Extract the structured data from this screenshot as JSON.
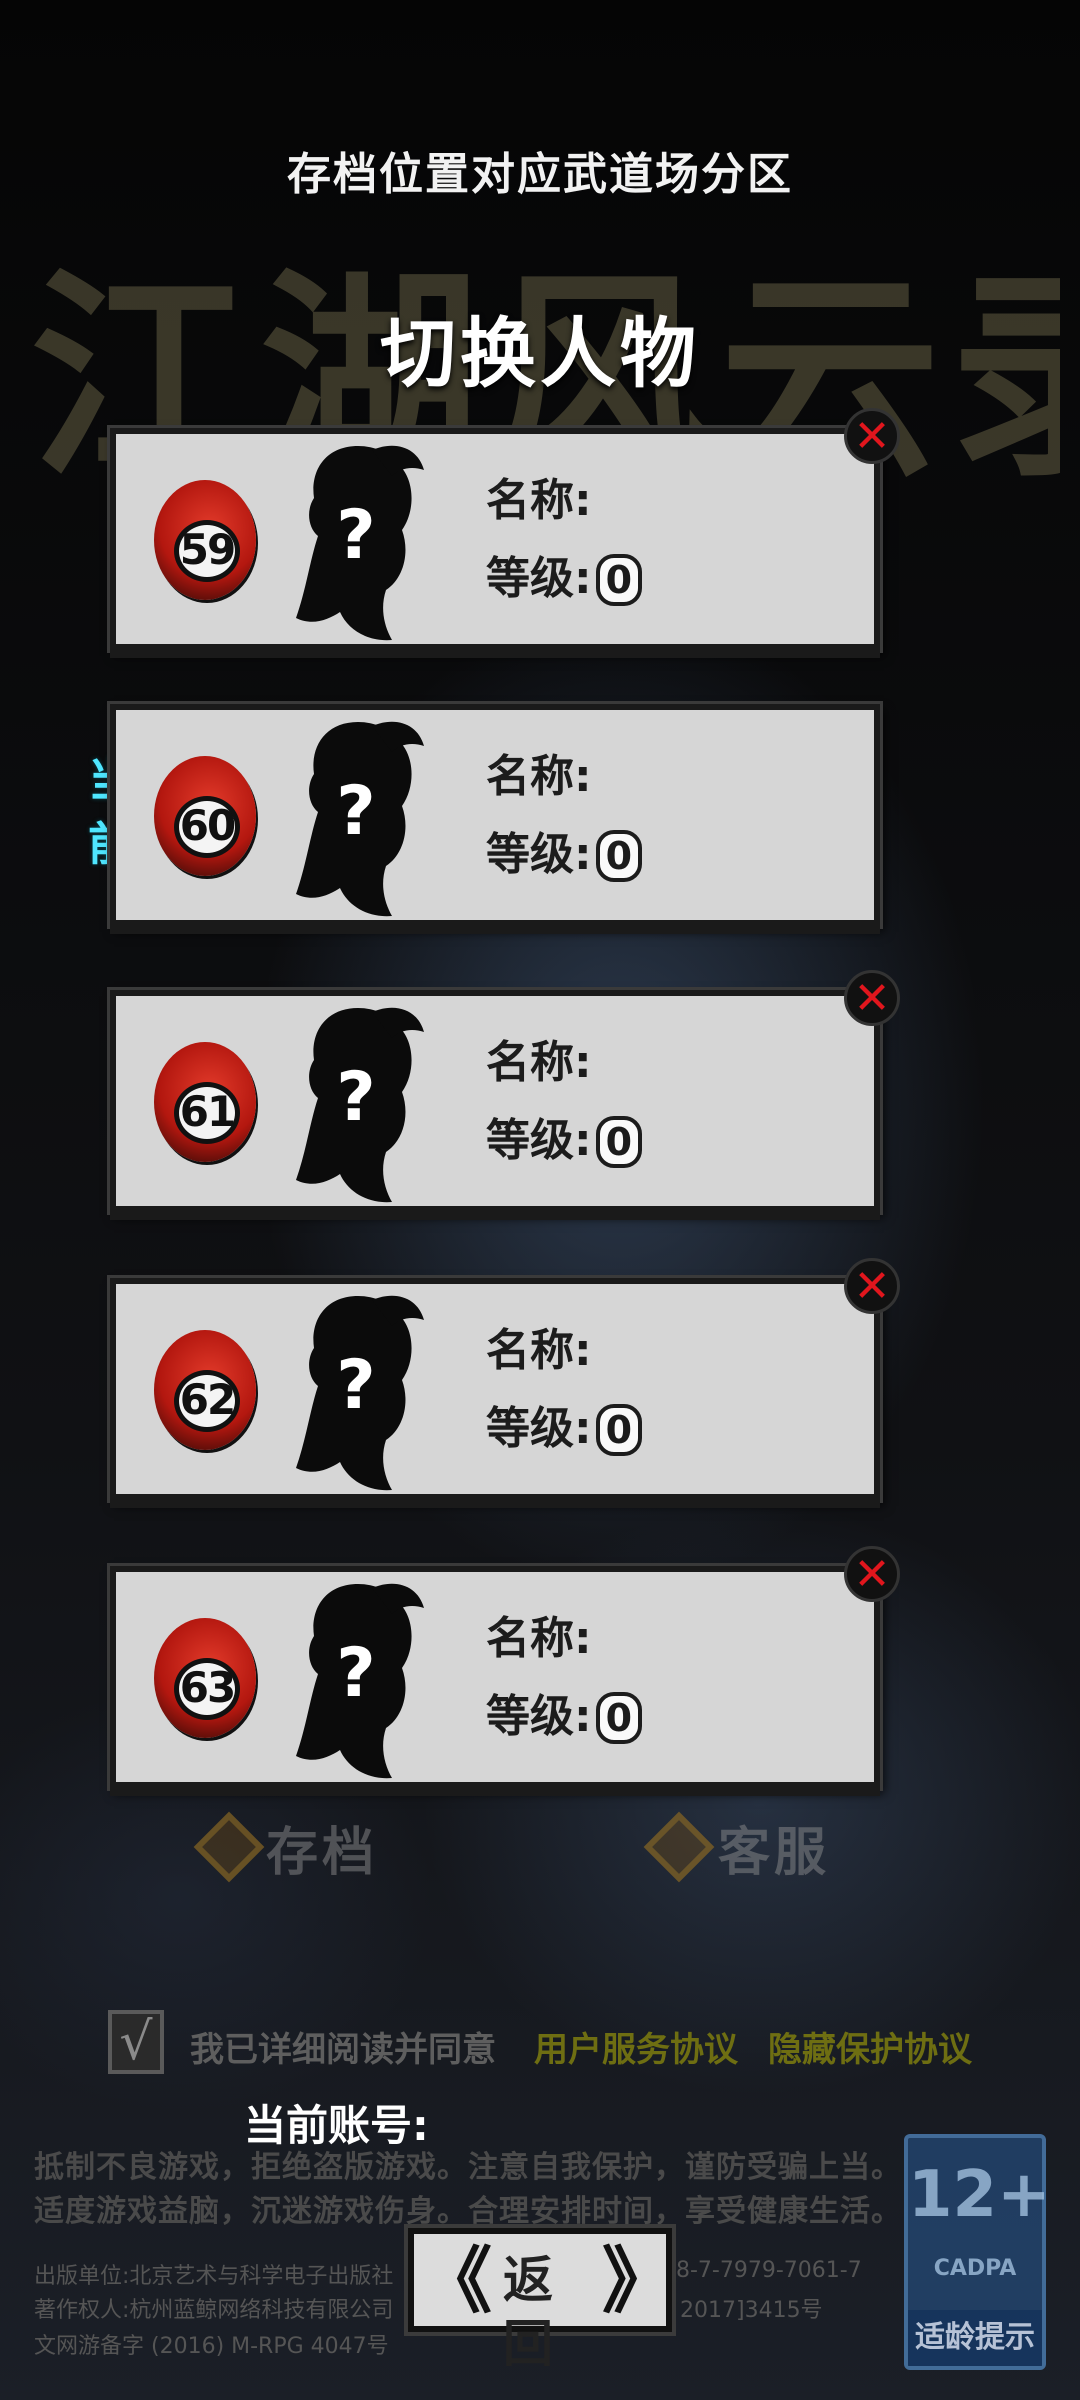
{
  "header": {
    "note": "存档位置对应武道场分区",
    "title": "切换人物"
  },
  "background_logo": "江湖风云录",
  "slots": [
    {
      "number": "59",
      "name_label": "名称:",
      "level_label": "等级:",
      "level_value": "0",
      "has_delete": true,
      "is_current": false
    },
    {
      "number": "60",
      "name_label": "名称:",
      "level_label": "等级:",
      "level_value": "0",
      "has_delete": false,
      "is_current": true
    },
    {
      "number": "61",
      "name_label": "名称:",
      "level_label": "等级:",
      "level_value": "0",
      "has_delete": true,
      "is_current": false
    },
    {
      "number": "62",
      "name_label": "名称:",
      "level_label": "等级:",
      "level_value": "0",
      "has_delete": true,
      "is_current": false
    },
    {
      "number": "63",
      "name_label": "名称:",
      "level_label": "等级:",
      "level_value": "0",
      "has_delete": true,
      "is_current": false
    }
  ],
  "avatar_placeholder": "?",
  "delete_glyph": "✕",
  "current_marker": {
    "line1": "当",
    "line2": "前"
  },
  "bottom_buttons": {
    "save": "存档",
    "service": "客服"
  },
  "agreement": {
    "checked": true,
    "check_glyph": "√",
    "text": "我已详细阅读并同意",
    "user_agreement": "用户服务协议",
    "privacy_agreement": "隐藏保护协议"
  },
  "account": {
    "label": "当前账号:"
  },
  "notice": {
    "line1": "抵制不良游戏，拒绝盗版游戏。注意自我保护，谨防受骗上当。",
    "line2": "适度游戏益脑，沉迷游戏伤身。合理安排时间，享受健康生活。"
  },
  "publisher": {
    "line1_left": "出版单位:北京艺术与科学电子出版社",
    "line1_right": "8-7-7979-7061-7",
    "line2_left": "著作权人:杭州蓝鲸网络科技有限公司",
    "line2_right": "2017]3415号",
    "line3": "文网游备字 (2016) M-RPG 4047号"
  },
  "back_button": {
    "label": "返 回",
    "left_arrow": "《",
    "right_arrow": "》"
  },
  "age_rating": {
    "rating": "12+",
    "org": "CADPA",
    "tip": "适龄提示"
  },
  "colors": {
    "current_marker": "#4fe6ff",
    "delete_x": "#e1161d",
    "seal_red": "#c21a10",
    "agreement_link": "#6e6e12"
  }
}
